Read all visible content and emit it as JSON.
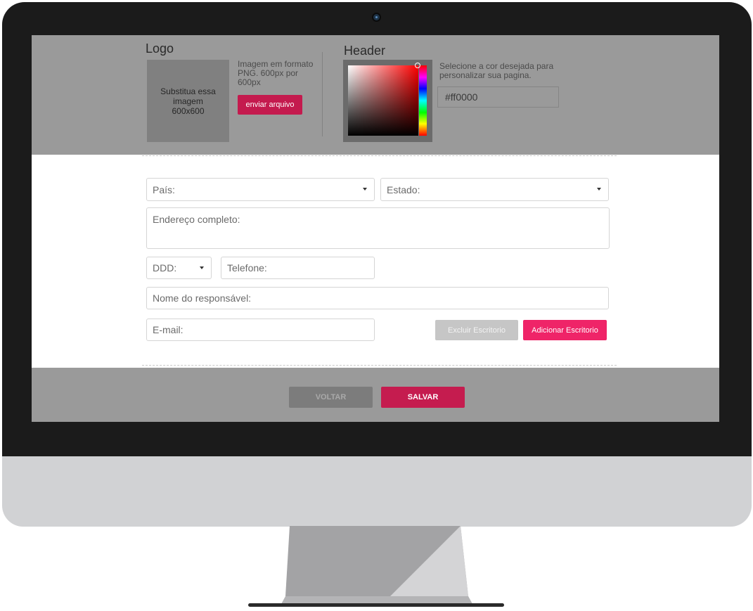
{
  "logo": {
    "title": "Logo",
    "placeholder_text": "Substitua essa imagem 600x600",
    "instructions": "Imagem em formato PNG. 600px por 600px",
    "upload_label": "enviar arquivo"
  },
  "header": {
    "title": "Header",
    "instructions": "Selecione a cor desejada para personalizar sua pagina.",
    "color_value": "#ff0000"
  },
  "form": {
    "country_placeholder": "País:",
    "state_placeholder": "Estado:",
    "address_placeholder": "Endereço completo:",
    "ddd_placeholder": "DDD:",
    "phone_placeholder": "Telefone:",
    "responsible_placeholder": "Nome do responsável:",
    "email_placeholder": "E-mail:",
    "delete_office_label": "Excluir Escritorio",
    "add_office_label": "Adicionar Escritorio"
  },
  "footer": {
    "back_label": "VOLTAR",
    "save_label": "SALVAR"
  },
  "colors": {
    "accent": "#ef2468",
    "accent_dark": "#c51c4f",
    "band_gray": "#9a9a9a"
  }
}
